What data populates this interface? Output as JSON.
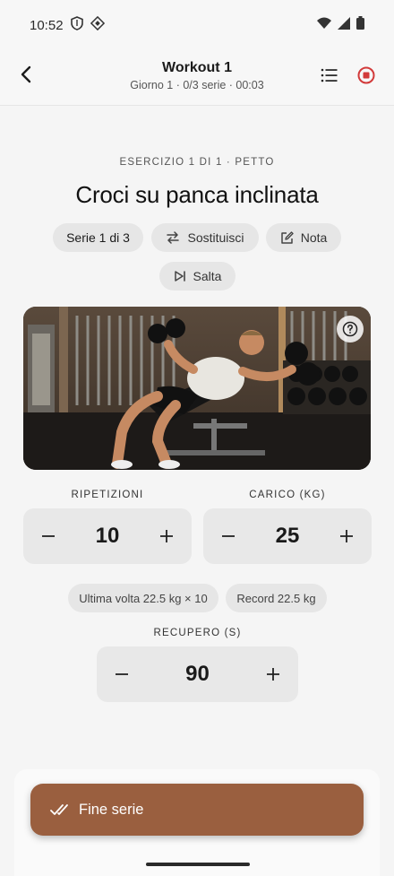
{
  "status_bar": {
    "time": "10:52"
  },
  "app_bar": {
    "title": "Workout 1",
    "subtitle": "Giorno 1 · 0/3 serie · 00:03"
  },
  "exercise": {
    "meta": "ESERCIZIO 1 DI 1 · PETTO",
    "title": "Croci su panca inclinata"
  },
  "chips": {
    "series": "Serie 1 di 3",
    "substitute": "Sostituisci",
    "note": "Nota",
    "skip": "Salta"
  },
  "reps": {
    "label": "RIPETIZIONI",
    "value": "10"
  },
  "load": {
    "label": "CARICO (KG)",
    "value": "25"
  },
  "history": {
    "last_time": "Ultima volta 22.5 kg × 10",
    "record": "Record 22.5 kg"
  },
  "rest": {
    "label": "RECUPERO (S)",
    "value": "90"
  },
  "finish_button": {
    "label": "Fine serie"
  },
  "colors": {
    "accent": "#9a5f3f",
    "stop": "#d23a3a"
  }
}
